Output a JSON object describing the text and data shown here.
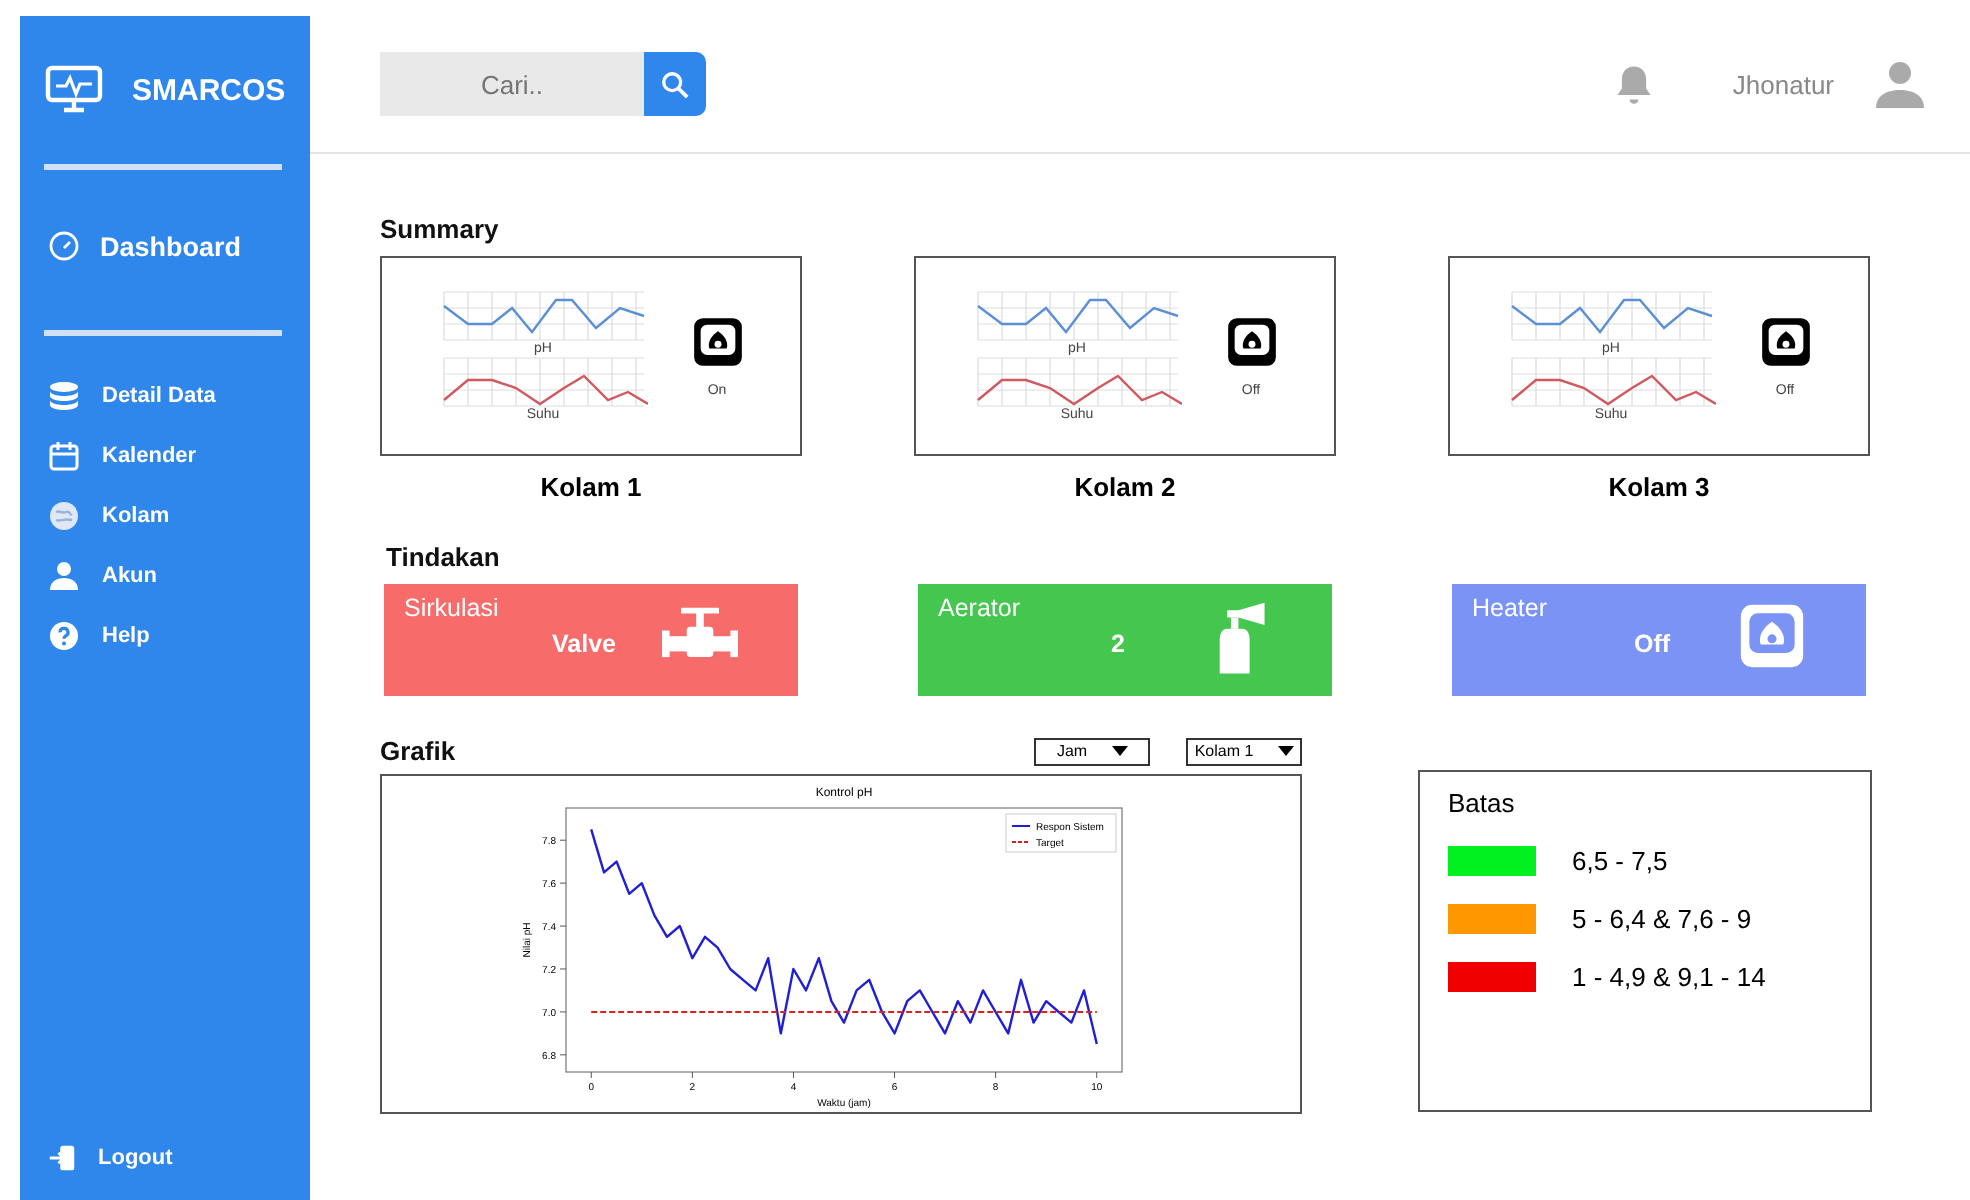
{
  "sidebar": {
    "brand": "SMARCOS",
    "dashboard": "Dashboard",
    "items": [
      {
        "label": "Detail Data",
        "kind": "database"
      },
      {
        "label": "Kalender",
        "kind": "calendar"
      },
      {
        "label": "Kolam",
        "kind": "pond"
      },
      {
        "label": "Akun",
        "kind": "user"
      },
      {
        "label": "Help",
        "kind": "help"
      }
    ],
    "logout": "Logout"
  },
  "header": {
    "search": {
      "placeholder": "Cari.."
    },
    "user": "Jhonatur"
  },
  "summary": {
    "title": "Summary",
    "cards": [
      {
        "name": "Kolam 1",
        "chart_1_label": "pH",
        "chart_2_label": "Suhu",
        "status": "On"
      },
      {
        "name": "Kolam 2",
        "chart_1_label": "pH",
        "chart_2_label": "Suhu",
        "status": "Off"
      },
      {
        "name": "Kolam 3",
        "chart_1_label": "pH",
        "chart_2_label": "Suhu",
        "status": "Off"
      }
    ]
  },
  "actions": {
    "title": "Tindakan",
    "items": [
      {
        "label": "Sirkulasi",
        "value": "Valve",
        "kind": "valve",
        "color": "#f76b6b"
      },
      {
        "label": "Aerator",
        "value": "2",
        "kind": "aerator",
        "color": "#45c74f"
      },
      {
        "label": "Heater",
        "value": "Off",
        "kind": "heater",
        "color": "#7b93f5"
      }
    ]
  },
  "graph": {
    "title": "Grafik",
    "filters": [
      "Jam",
      "Kolam 1"
    ],
    "chart_data": {
      "type": "line",
      "title": "Kontrol pH",
      "xlabel": "Waktu (jam)",
      "ylabel": "Nilai pH",
      "x": [
        0,
        0.25,
        0.5,
        0.75,
        1,
        1.25,
        1.5,
        1.75,
        2,
        2.25,
        2.5,
        2.75,
        3,
        3.25,
        3.5,
        3.75,
        4,
        4.25,
        4.5,
        4.75,
        5,
        5.25,
        5.5,
        5.75,
        6,
        6.25,
        6.5,
        6.75,
        7,
        7.25,
        7.5,
        7.75,
        8,
        8.25,
        8.5,
        8.75,
        9,
        9.25,
        9.5,
        9.75,
        10
      ],
      "series": [
        {
          "name": "Respon Sistem",
          "color": "#1f1fd6",
          "line_style": "solid",
          "values": [
            7.85,
            7.65,
            7.7,
            7.55,
            7.6,
            7.45,
            7.35,
            7.4,
            7.25,
            7.35,
            7.3,
            7.2,
            7.15,
            7.1,
            7.25,
            6.9,
            7.2,
            7.1,
            7.25,
            7.05,
            6.95,
            7.1,
            7.15,
            7.0,
            6.9,
            7.05,
            7.1,
            7.0,
            6.9,
            7.05,
            6.95,
            7.1,
            7.0,
            6.9,
            7.15,
            6.95,
            7.05,
            7.0,
            6.95,
            7.1,
            6.85
          ]
        },
        {
          "name": "Target",
          "color": "#e02020",
          "line_style": "dashed",
          "values": [
            7.0,
            7.0,
            7.0,
            7.0,
            7.0,
            7.0,
            7.0,
            7.0,
            7.0,
            7.0,
            7.0,
            7.0,
            7.0,
            7.0,
            7.0,
            7.0,
            7.0,
            7.0,
            7.0,
            7.0,
            7.0,
            7.0,
            7.0,
            7.0,
            7.0,
            7.0,
            7.0,
            7.0,
            7.0,
            7.0,
            7.0,
            7.0,
            7.0,
            7.0,
            7.0,
            7.0,
            7.0,
            7.0,
            7.0,
            7.0,
            7.0
          ]
        }
      ],
      "legend": true,
      "xlim": [
        -0.5,
        10.5
      ],
      "ylim": [
        6.72,
        7.95
      ],
      "xticks": [
        0,
        2,
        4,
        6,
        8,
        10
      ],
      "yticks": [
        {
          "value": 6.8,
          "label": "6.8"
        },
        {
          "value": 7.0,
          "label": "7.0"
        },
        {
          "value": 7.2,
          "label": "7.2"
        },
        {
          "value": 7.4,
          "label": "7.4"
        },
        {
          "value": 7.6,
          "label": "7.6"
        },
        {
          "value": 7.8,
          "label": "7.8"
        }
      ]
    }
  },
  "limits": {
    "title": "Batas",
    "items": [
      {
        "label": "6,5 - 7,5",
        "color": "#00f020"
      },
      {
        "label": "5 - 6,4 & 7,6 - 9",
        "color": "#ff9800"
      },
      {
        "label": "1 - 4,9 & 9,1 - 14",
        "color": "#f00000"
      }
    ]
  }
}
